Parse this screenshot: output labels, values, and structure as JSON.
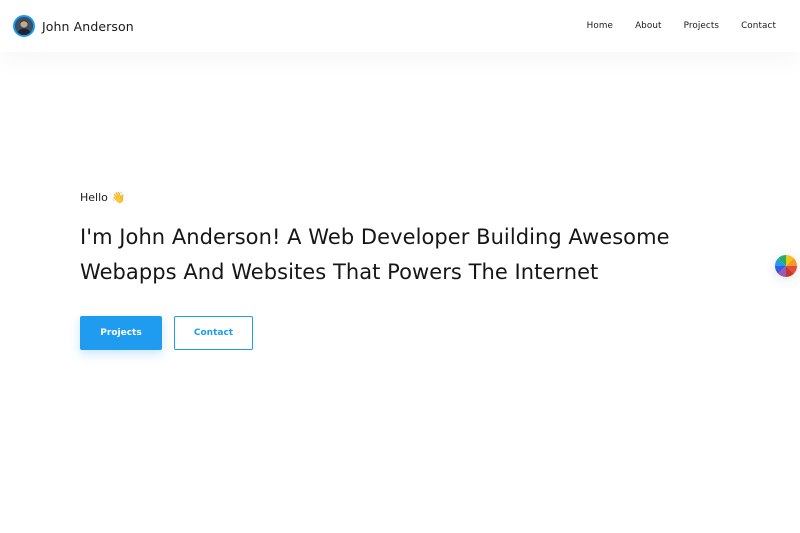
{
  "header": {
    "brand_name": "John Anderson",
    "avatar_icon": "user-avatar",
    "nav": [
      {
        "label": "Home"
      },
      {
        "label": "About"
      },
      {
        "label": "Projects"
      },
      {
        "label": "Contact"
      }
    ]
  },
  "hero": {
    "greeting": "Hello",
    "greeting_emoji": "👋",
    "headline_line1": "I'm John Anderson! A Web Developer Building Awesome",
    "headline_line2": "Webapps And Websites That Powers The Internet",
    "primary_button": "Projects",
    "secondary_button": "Contact"
  },
  "theme_switch": {
    "icon": "color-wheel-icon"
  },
  "colors": {
    "accent": "#1f9cf0",
    "text": "#1a1a1a",
    "background": "#ffffff"
  }
}
